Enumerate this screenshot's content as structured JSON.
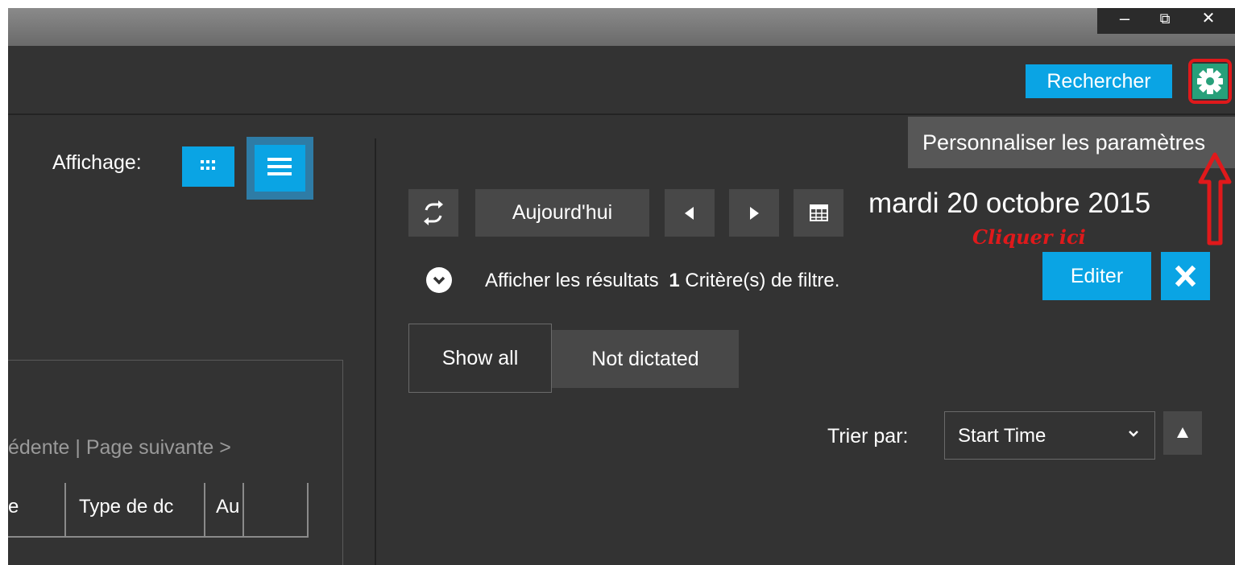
{
  "window": {
    "minimize": "–",
    "restore": "⧉",
    "close": "✕"
  },
  "topbar": {
    "search_label": "Rechercher",
    "settings_icon": "gear-icon",
    "tooltip": "Personnaliser les paramètres"
  },
  "annotation": {
    "label": "Cliquer ici",
    "color": "#e0191b"
  },
  "left": {
    "view_label": "Affichage:",
    "pagination": "édente | Page suivante >",
    "columns": [
      "e",
      "Type de dc",
      "Au",
      ""
    ]
  },
  "right": {
    "today_label": "Aujourd'hui",
    "date": "mardi 20 octobre 2015",
    "results_label": "Afficher les résultats",
    "filter_count": "1",
    "filter_text": "Critère(s) de filtre.",
    "edit_label": "Editer",
    "tabs": [
      "Show all",
      "Not dictated"
    ],
    "sort_label": "Trier par:",
    "sort_value": "Start Time"
  },
  "colors": {
    "accent": "#0aa4e4",
    "settings_green": "#27a07a",
    "background": "#333333"
  }
}
